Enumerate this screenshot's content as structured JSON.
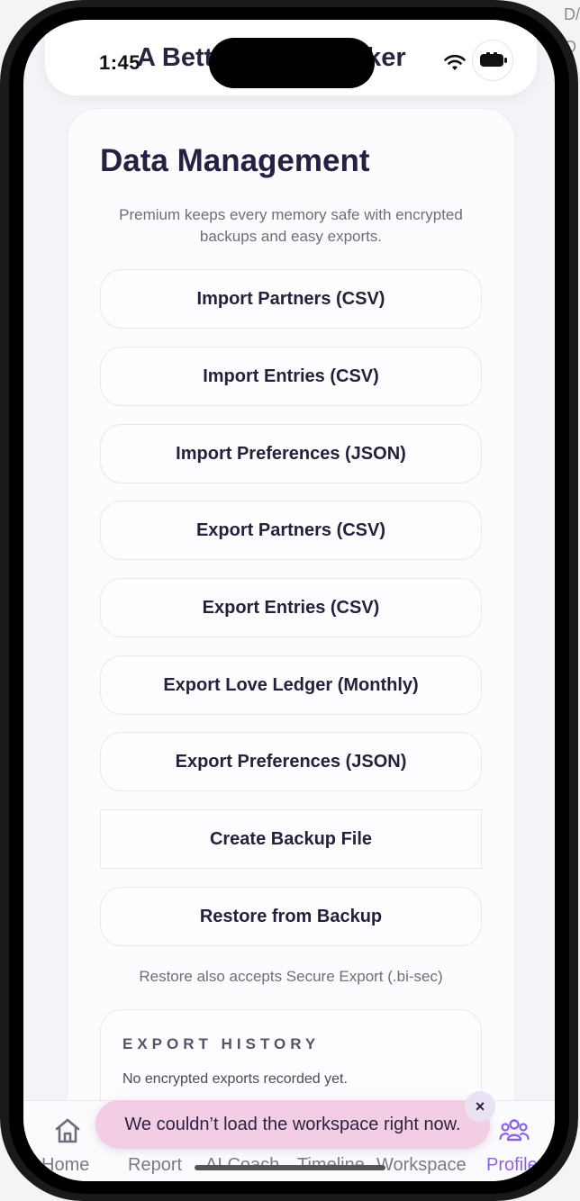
{
  "status_bar": {
    "time": "1:45"
  },
  "header": {
    "app_title": "A Better Love Tracker"
  },
  "background_edge": {
    "text_1": "D/",
    "text_2": "O"
  },
  "data_management": {
    "title": "Data Management",
    "subtitle": "Premium keeps every memory safe with encrypted backups and easy exports.",
    "buttons": [
      {
        "label": "Import Partners (CSV)"
      },
      {
        "label": "Import Entries (CSV)"
      },
      {
        "label": "Import Preferences (JSON)"
      },
      {
        "label": "Export Partners (CSV)"
      },
      {
        "label": "Export Entries (CSV)"
      },
      {
        "label": "Export Love Ledger (Monthly)"
      },
      {
        "label": "Export Preferences (JSON)"
      },
      {
        "label": "Create Backup File"
      },
      {
        "label": "Restore from Backup"
      }
    ],
    "restore_note": "Restore also accepts Secure Export (.bi-sec)",
    "export_history": {
      "title": "EXPORT HISTORY",
      "empty_text": "No encrypted exports recorded yet."
    }
  },
  "toast": {
    "message": "We couldn’t load the workspace right now.",
    "close_label": "×"
  },
  "tabbar": {
    "tabs": [
      {
        "label": "Home",
        "icon": "home-icon",
        "active": false
      },
      {
        "label": "Report",
        "icon": "report-icon",
        "active": false
      },
      {
        "label": "AI Coach",
        "icon": "ai-coach-icon",
        "active": false
      },
      {
        "label": "Timeline",
        "icon": "timeline-icon",
        "active": false
      },
      {
        "label": "Workspace",
        "icon": "workspace-icon",
        "active": false
      },
      {
        "label": "Profile",
        "icon": "people-icon",
        "active": true
      }
    ]
  },
  "colors": {
    "accent": "#8b63e8",
    "toast_bg": "#f3cde3",
    "title_text": "#262140"
  }
}
